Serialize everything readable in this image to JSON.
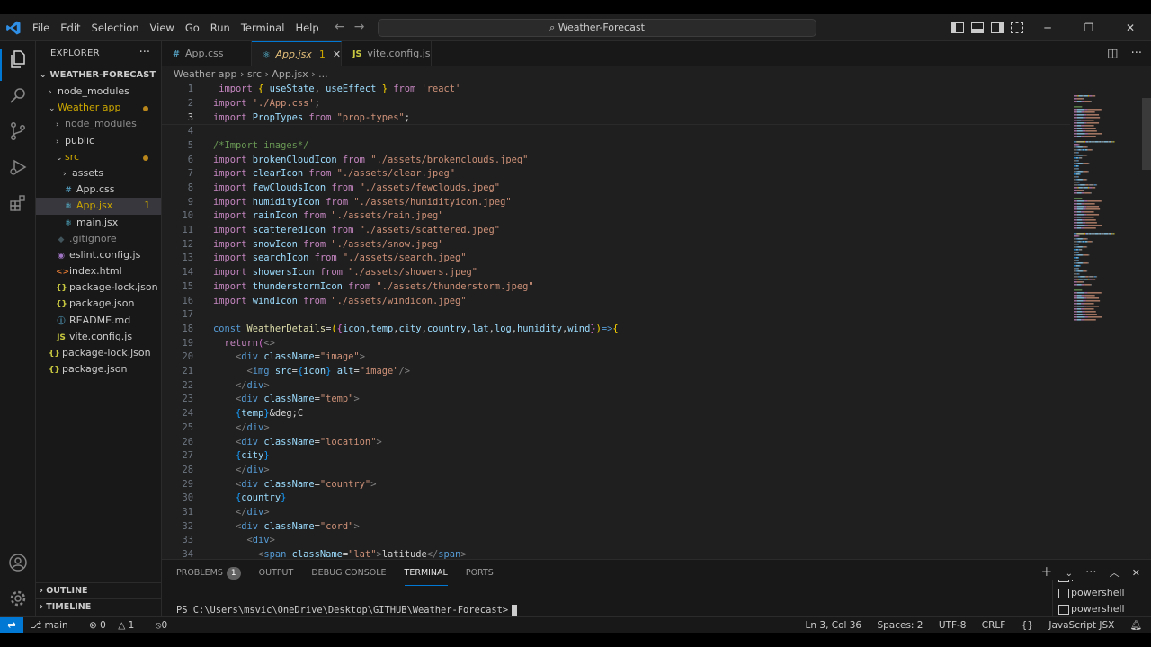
{
  "menu": [
    "File",
    "Edit",
    "Selection",
    "View",
    "Go",
    "Run",
    "Terminal",
    "Help"
  ],
  "search": {
    "label": "Weather-Forecast"
  },
  "explorer": {
    "header": "EXPLORER",
    "root": "WEATHER-FORECAST",
    "items": [
      {
        "label": "node_modules",
        "depth": 0,
        "chev": "›",
        "icon": ""
      },
      {
        "label": "Weather app",
        "depth": 0,
        "chev": "⌄",
        "icon": "",
        "mod": true
      },
      {
        "label": "node_modules",
        "depth": 1,
        "chev": "›",
        "icon": ""
      },
      {
        "label": "public",
        "depth": 1,
        "chev": "›",
        "icon": ""
      },
      {
        "label": "src",
        "depth": 1,
        "chev": "⌄",
        "icon": "",
        "mod": true
      },
      {
        "label": "assets",
        "depth": 2,
        "chev": "›",
        "icon": ""
      },
      {
        "label": "App.css",
        "depth": 2,
        "chev": "",
        "icon": "#"
      },
      {
        "label": "App.jsx",
        "depth": 2,
        "chev": "",
        "icon": "⚛",
        "badge": "1",
        "selected": true
      },
      {
        "label": "main.jsx",
        "depth": 2,
        "chev": "",
        "icon": "⚛"
      },
      {
        "label": ".gitignore",
        "depth": 1,
        "chev": "",
        "icon": "◆"
      },
      {
        "label": "eslint.config.js",
        "depth": 1,
        "chev": "",
        "icon": "◉"
      },
      {
        "label": "index.html",
        "depth": 1,
        "chev": "",
        "icon": "<>"
      },
      {
        "label": "package-lock.json",
        "depth": 1,
        "chev": "",
        "icon": "{}"
      },
      {
        "label": "package.json",
        "depth": 1,
        "chev": "",
        "icon": "{}"
      },
      {
        "label": "README.md",
        "depth": 1,
        "chev": "",
        "icon": "ⓘ"
      },
      {
        "label": "vite.config.js",
        "depth": 1,
        "chev": "",
        "icon": "JS"
      },
      {
        "label": "package-lock.json",
        "depth": 0,
        "chev": "",
        "icon": "{}"
      },
      {
        "label": "package.json",
        "depth": 0,
        "chev": "",
        "icon": "{}"
      }
    ],
    "outline": "OUTLINE",
    "timeline": "TIMELINE"
  },
  "tabs": [
    {
      "label": "App.css",
      "icon": "#",
      "active": false
    },
    {
      "label": "App.jsx",
      "icon": "⚛",
      "active": true,
      "badge": "1"
    },
    {
      "label": "vite.config.js",
      "icon": "JS",
      "active": false
    }
  ],
  "breadcrumb": [
    "Weather app",
    "src",
    "App.jsx",
    "..."
  ],
  "editor": {
    "current_line": 3,
    "lines": [
      [
        [
          "kw",
          " import "
        ],
        [
          "br1",
          "{ "
        ],
        [
          "vr",
          "useState"
        ],
        [
          "pl",
          ", "
        ],
        [
          "vr",
          "useEffect"
        ],
        [
          "br1",
          " }"
        ],
        [
          "kw",
          " from "
        ],
        [
          "st",
          "'react'"
        ]
      ],
      [
        [
          "kw",
          "import "
        ],
        [
          "st",
          "'./App.css'"
        ],
        [
          "pl",
          ";"
        ]
      ],
      [
        [
          "kw",
          "import "
        ],
        [
          "vr",
          "PropTypes"
        ],
        [
          "kw",
          " from "
        ],
        [
          "st",
          "\"prop-types\""
        ],
        [
          "pl",
          ";"
        ]
      ],
      [],
      [
        [
          "cm",
          "/*Import images*/"
        ]
      ],
      [
        [
          "kw",
          "import "
        ],
        [
          "vr",
          "brokenCloudIcon"
        ],
        [
          "kw",
          " from "
        ],
        [
          "st",
          "\"./assets/brokenclouds.jpeg\""
        ]
      ],
      [
        [
          "kw",
          "import "
        ],
        [
          "vr",
          "clearIcon"
        ],
        [
          "kw",
          " from "
        ],
        [
          "st",
          "\"./assets/clear.jpeg\""
        ]
      ],
      [
        [
          "kw",
          "import "
        ],
        [
          "vr",
          "fewCloudsIcon"
        ],
        [
          "kw",
          " from "
        ],
        [
          "st",
          "\"./assets/fewclouds.jpeg\""
        ]
      ],
      [
        [
          "kw",
          "import "
        ],
        [
          "vr",
          "humidityIcon"
        ],
        [
          "kw",
          " from "
        ],
        [
          "st",
          "\"./assets/humidityicon.jpeg\""
        ]
      ],
      [
        [
          "kw",
          "import "
        ],
        [
          "vr",
          "rainIcon"
        ],
        [
          "kw",
          " from "
        ],
        [
          "st",
          "\"./assets/rain.jpeg\""
        ]
      ],
      [
        [
          "kw",
          "import "
        ],
        [
          "vr",
          "scatteredIcon"
        ],
        [
          "kw",
          " from "
        ],
        [
          "st",
          "\"./assets/scattered.jpeg\""
        ]
      ],
      [
        [
          "kw",
          "import "
        ],
        [
          "vr",
          "snowIcon"
        ],
        [
          "kw",
          " from "
        ],
        [
          "st",
          "\"./assets/snow.jpeg\""
        ]
      ],
      [
        [
          "kw",
          "import "
        ],
        [
          "vr",
          "searchIcon"
        ],
        [
          "kw",
          " from "
        ],
        [
          "st",
          "\"./assets/search.jpeg\""
        ]
      ],
      [
        [
          "kw",
          "import "
        ],
        [
          "vr",
          "showersIcon"
        ],
        [
          "kw",
          " from "
        ],
        [
          "st",
          "\"./assets/showers.jpeg\""
        ]
      ],
      [
        [
          "kw",
          "import "
        ],
        [
          "vr",
          "thunderstormIcon"
        ],
        [
          "kw",
          " from "
        ],
        [
          "st",
          "\"./assets/thunderstorm.jpeg\""
        ]
      ],
      [
        [
          "kw",
          "import "
        ],
        [
          "vr",
          "windIcon"
        ],
        [
          "kw",
          " from "
        ],
        [
          "st",
          "\"./assets/windicon.jpeg\""
        ]
      ],
      [],
      [
        [
          "kb",
          "const "
        ],
        [
          "fn",
          "WeatherDetails"
        ],
        [
          "pl",
          "="
        ],
        [
          "br1",
          "("
        ],
        [
          "br2",
          "{"
        ],
        [
          "vr",
          "icon"
        ],
        [
          "pl",
          ","
        ],
        [
          "vr",
          "temp"
        ],
        [
          "pl",
          ","
        ],
        [
          "vr",
          "city"
        ],
        [
          "pl",
          ","
        ],
        [
          "vr",
          "country"
        ],
        [
          "pl",
          ","
        ],
        [
          "vr",
          "lat"
        ],
        [
          "pl",
          ","
        ],
        [
          "vr",
          "log"
        ],
        [
          "pl",
          ","
        ],
        [
          "vr",
          "humidity"
        ],
        [
          "pl",
          ","
        ],
        [
          "vr",
          "wind"
        ],
        [
          "br2",
          "}"
        ],
        [
          "br1",
          ")"
        ],
        [
          "kb",
          "=>"
        ],
        [
          "br1",
          "{"
        ]
      ],
      [
        [
          "kw",
          "  return"
        ],
        [
          "br2",
          "("
        ],
        [
          "gb",
          "<>"
        ]
      ],
      [
        [
          "gb",
          "    <"
        ],
        [
          "tg",
          "div"
        ],
        [
          "vr",
          " className"
        ],
        [
          "pl",
          "="
        ],
        [
          "st",
          "\"image\""
        ],
        [
          "gb",
          ">"
        ]
      ],
      [
        [
          "gb",
          "      <"
        ],
        [
          "tg",
          "img"
        ],
        [
          "vr",
          " src"
        ],
        [
          "pl",
          "="
        ],
        [
          "br3",
          "{"
        ],
        [
          "vr",
          "icon"
        ],
        [
          "br3",
          "}"
        ],
        [
          "vr",
          " alt"
        ],
        [
          "pl",
          "="
        ],
        [
          "st",
          "\"image\""
        ],
        [
          "gb",
          "/>"
        ]
      ],
      [
        [
          "gb",
          "    </"
        ],
        [
          "tg",
          "div"
        ],
        [
          "gb",
          ">"
        ]
      ],
      [
        [
          "gb",
          "    <"
        ],
        [
          "tg",
          "div"
        ],
        [
          "vr",
          " className"
        ],
        [
          "pl",
          "="
        ],
        [
          "st",
          "\"temp\""
        ],
        [
          "gb",
          ">"
        ]
      ],
      [
        [
          "br3",
          "    {"
        ],
        [
          "vr",
          "temp"
        ],
        [
          "br3",
          "}"
        ],
        [
          "pl",
          "&deg;C"
        ]
      ],
      [
        [
          "gb",
          "    </"
        ],
        [
          "tg",
          "div"
        ],
        [
          "gb",
          ">"
        ]
      ],
      [
        [
          "gb",
          "    <"
        ],
        [
          "tg",
          "div"
        ],
        [
          "vr",
          " className"
        ],
        [
          "pl",
          "="
        ],
        [
          "st",
          "\"location\""
        ],
        [
          "gb",
          ">"
        ]
      ],
      [
        [
          "br3",
          "    {"
        ],
        [
          "vr",
          "city"
        ],
        [
          "br3",
          "}"
        ]
      ],
      [
        [
          "gb",
          "    </"
        ],
        [
          "tg",
          "div"
        ],
        [
          "gb",
          ">"
        ]
      ],
      [
        [
          "gb",
          "    <"
        ],
        [
          "tg",
          "div"
        ],
        [
          "vr",
          " className"
        ],
        [
          "pl",
          "="
        ],
        [
          "st",
          "\"country\""
        ],
        [
          "gb",
          ">"
        ]
      ],
      [
        [
          "br3",
          "    {"
        ],
        [
          "vr",
          "country"
        ],
        [
          "br3",
          "}"
        ]
      ],
      [
        [
          "gb",
          "    </"
        ],
        [
          "tg",
          "div"
        ],
        [
          "gb",
          ">"
        ]
      ],
      [
        [
          "gb",
          "    <"
        ],
        [
          "tg",
          "div"
        ],
        [
          "vr",
          " className"
        ],
        [
          "pl",
          "="
        ],
        [
          "st",
          "\"cord\""
        ],
        [
          "gb",
          ">"
        ]
      ],
      [
        [
          "gb",
          "      <"
        ],
        [
          "tg",
          "div"
        ],
        [
          "gb",
          ">"
        ]
      ],
      [
        [
          "gb",
          "        <"
        ],
        [
          "tg",
          "span"
        ],
        [
          "vr",
          " className"
        ],
        [
          "pl",
          "="
        ],
        [
          "st",
          "\"lat\""
        ],
        [
          "gb",
          ">"
        ],
        [
          "pl",
          "latitude"
        ],
        [
          "gb",
          "</"
        ],
        [
          "tg",
          "span"
        ],
        [
          "gb",
          ">"
        ]
      ]
    ]
  },
  "panel": {
    "tabs": [
      {
        "label": "PROBLEMS",
        "badge": "1"
      },
      {
        "label": "OUTPUT"
      },
      {
        "label": "DEBUG CONSOLE"
      },
      {
        "label": "TERMINAL",
        "active": true
      },
      {
        "label": "PORTS"
      }
    ],
    "prompt": "PS C:\\Users\\msvic\\OneDrive\\Desktop\\GITHUB\\Weather-Forecast>",
    "terminals": [
      "powershell",
      "powershell",
      "powershell"
    ]
  },
  "status": {
    "branch": "main",
    "errors": "0",
    "warnings": "1",
    "ports": "0",
    "position": "Ln 3, Col 36",
    "spaces": "Spaces: 2",
    "encoding": "UTF-8",
    "eol": "CRLF",
    "language": "JavaScript JSX"
  },
  "colors": {
    "accent": "#0078d4",
    "modified": "#cca700"
  }
}
